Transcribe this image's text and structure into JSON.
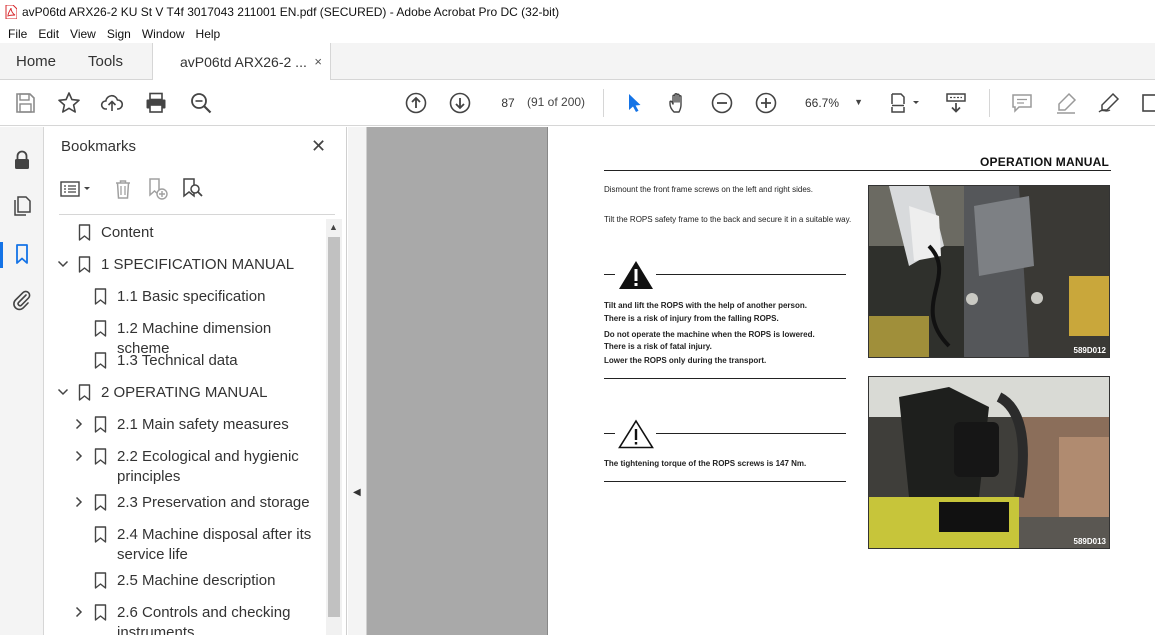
{
  "window": {
    "title": "avP06td ARX26-2 KU St V T4f 3017043 211001 EN.pdf (SECURED) - Adobe Acrobat Pro DC (32-bit)"
  },
  "menu": [
    "File",
    "Edit",
    "View",
    "Sign",
    "Window",
    "Help"
  ],
  "tabs": {
    "home": "Home",
    "tools": "Tools",
    "document": "avP06td ARX26-2 ...",
    "close_glyph": "×"
  },
  "toolbar": {
    "page_current": "87",
    "page_count": "(91 of 200)",
    "zoom": "66.7%"
  },
  "bookmarks": {
    "title": "Bookmarks",
    "close_glyph": "✕",
    "items": [
      {
        "label": "Content",
        "level": 0,
        "expander": "none"
      },
      {
        "label": "1 SPECIFICATION MANUAL",
        "level": 0,
        "expander": "expanded"
      },
      {
        "label": "1.1 Basic specification",
        "level": 1,
        "expander": "none"
      },
      {
        "label": "1.2 Machine dimension scheme",
        "level": 1,
        "expander": "none"
      },
      {
        "label": "1.3 Technical data",
        "level": 1,
        "expander": "none"
      },
      {
        "label": "2 OPERATING MANUAL",
        "level": 0,
        "expander": "expanded"
      },
      {
        "label": "2.1 Main safety measures",
        "level": 1,
        "expander": "collapsed"
      },
      {
        "label": "2.2 Ecological and hygienic principles",
        "level": 1,
        "expander": "collapsed"
      },
      {
        "label": "2.3 Preservation and storage",
        "level": 1,
        "expander": "collapsed"
      },
      {
        "label": "2.4 Machine disposal after its service life",
        "level": 1,
        "expander": "none"
      },
      {
        "label": "2.5 Machine description",
        "level": 1,
        "expander": "none"
      },
      {
        "label": "2.6 Controls and checking instruments",
        "level": 1,
        "expander": "collapsed"
      }
    ]
  },
  "page": {
    "header": "OPERATION MANUAL",
    "step1": "Dismount the front frame screws on the left and right sides.",
    "step2": "Tilt the ROPS safety frame to the back and secure it in a suitable way.",
    "warning_lines": [
      "Tilt and lift the ROPS with the help of another person.",
      "There is a risk of injury from the falling ROPS.",
      "Do not operate the machine when the ROPS is lowered.",
      "There is a risk of fatal injury.",
      "Lower the ROPS only during the transport."
    ],
    "caution": "The tightening torque of the ROPS screws is 147 Nm.",
    "photo1_caption": "589D012",
    "photo2_caption": "589D013"
  },
  "colors": {
    "accent": "#1473e6",
    "chrome": "#f4f4f4",
    "doc_bg": "#a9a9a9",
    "pdf_red": "#d7262a"
  }
}
